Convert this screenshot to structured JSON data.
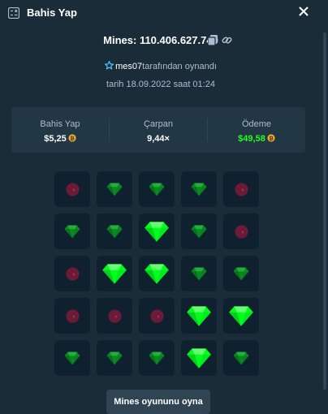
{
  "header": {
    "title": "Bahis Yap",
    "icon": "bet-slip-icon",
    "close_icon": "close-icon"
  },
  "game": {
    "id_text": "Mines: 110.406.627.740",
    "copy_icon": "copy-icon",
    "link_icon": "link-icon",
    "player_icon": "star-icon",
    "username": "mes07",
    "played_by_suffix": "tarafından oynandı",
    "date_text": "tarih 18.09.2022 saat 01:24"
  },
  "stats": {
    "bet": {
      "label": "Bahis Yap",
      "value": "$5,25"
    },
    "multiplier": {
      "label": "Çarpan",
      "value": "9,44×"
    },
    "payout": {
      "label": "Ödeme",
      "value": "$49,58"
    },
    "coin_icon": "coin-icon",
    "payout_color": "#1fff20"
  },
  "board": {
    "rows": [
      [
        "mine",
        "gem",
        "gem",
        "gem",
        "mine"
      ],
      [
        "gem",
        "gem",
        "gem-revealed",
        "gem",
        "mine"
      ],
      [
        "mine",
        "gem-revealed",
        "gem-revealed",
        "gem",
        "gem"
      ],
      [
        "mine",
        "mine",
        "mine",
        "gem-revealed",
        "gem-revealed"
      ],
      [
        "gem",
        "gem",
        "gem",
        "gem-revealed",
        "gem"
      ]
    ]
  },
  "colors": {
    "background": "#1a2c38",
    "tile": "#0f212e",
    "panel": "#213743",
    "gem_revealed": "#00ff1f",
    "gem_dim": "#0a8a22",
    "mine_dim": "#6b1a38"
  },
  "play_button": {
    "label": "Mines oyununu oyna"
  }
}
